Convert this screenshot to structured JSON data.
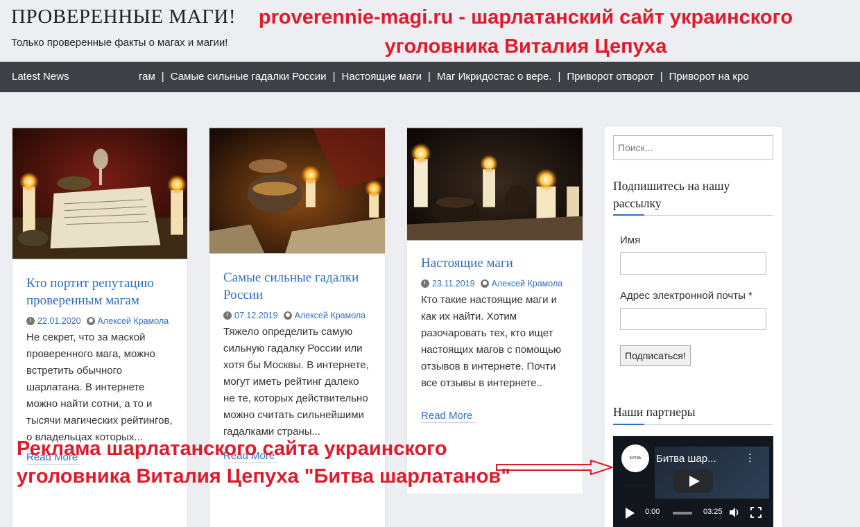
{
  "header": {
    "site_title": "ПРОВЕРЕННЫЕ МАГИ!",
    "site_description": "Только проверенные факты о магах и магии!",
    "overlay_line1": "proverennie-magi.ru - шарлатанский сайт украинского",
    "overlay_line2": "уголовника Виталия Цепуха"
  },
  "newsbar": {
    "label": "Latest News",
    "items": [
      "гам",
      "Самые сильные гадалки России",
      "Настоящие маги",
      "Маг Икридостас о вере.",
      "Приворот отворот",
      "Приворот на кро"
    ]
  },
  "cards": [
    {
      "title": "Кто портит репутацию проверенным магам",
      "date": "22.01.2020",
      "author": "Алексей Крамола",
      "excerpt": "Не секрет, что за маской проверенного мага, можно встретить обычного шарлатана. В интернете можно найти сотни, а то и тысячи магических рейтингов, о владельцах которых...",
      "read_more": "Read More"
    },
    {
      "title": "Самые сильные гадалки России",
      "date": "07.12.2019",
      "author": "Алексей Крамола",
      "excerpt": "Тяжело определить самую сильную гадалку России или хотя бы Москвы. В интернете, могут иметь рейтинг далеко не те, которых действительно можно считать сильнейшими гадалками страны...",
      "read_more": "Read More"
    },
    {
      "title": "Настоящие маги",
      "date": "23.11.2019",
      "author": "Алексей Крамола",
      "excerpt": "Кто такие настоящие маги и как их найти. Хотим разочаровать тех, кто ищет настоящих магов с помощью отзывов в интернете. Почти все отзывы в интернете..",
      "read_more": "Read More"
    }
  ],
  "sidebar": {
    "search_placeholder": "Поиск...",
    "newsletter_title": "Подпишитесь на нашу рассылку",
    "name_label": "Имя",
    "email_label": "Адрес электронной почты *",
    "subscribe_label": "Подписаться!",
    "partners_title": "Наши партнеры",
    "video": {
      "title": "Битва шар...",
      "channel_text": "БИТВА ШАРЛАТАНОВ",
      "time_current": "0:00",
      "time_total": "03:25"
    }
  },
  "overlay_bottom": {
    "line1": "Реклама шарлатанского сайта украинского",
    "line2": "уголовника Виталия Цепуха \"Битва шарлатанов\""
  },
  "colors": {
    "accent": "#2e6fbf",
    "overlay_red": "#e0192b",
    "newsbar_bg": "#3d4146"
  }
}
